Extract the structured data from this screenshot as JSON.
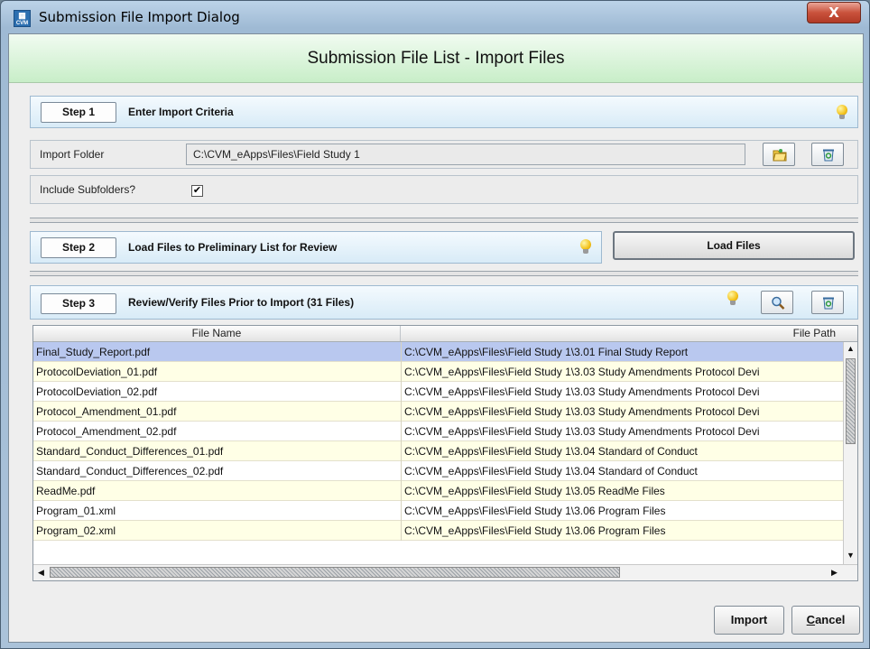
{
  "window": {
    "title": "Submission File Import Dialog",
    "app_icon_text": "CVM",
    "close_glyph": "X"
  },
  "header": {
    "title": "Submission File List - Import Files"
  },
  "step1": {
    "button": "Step 1",
    "label": "Enter Import Criteria",
    "import_folder_label": "Import Folder",
    "import_folder_value": "C:\\CVM_eApps\\Files\\Field Study 1",
    "include_subfolders_label": "Include Subfolders?",
    "include_subfolders_checked": "✔"
  },
  "step2": {
    "button": "Step 2",
    "label": "Load Files to Preliminary List for Review",
    "load_button": "Load Files"
  },
  "step3": {
    "button": "Step 3",
    "label": "Review/Verify Files Prior to Import  (31 Files)"
  },
  "grid": {
    "columns": [
      "File Name",
      "File Path"
    ],
    "rows": [
      {
        "name": "Final_Study_Report.pdf",
        "path": "C:\\CVM_eApps\\Files\\Field Study 1\\3.01 Final Study Report"
      },
      {
        "name": "ProtocolDeviation_01.pdf",
        "path": "C:\\CVM_eApps\\Files\\Field Study 1\\3.03 Study Amendments Protocol Devi"
      },
      {
        "name": "ProtocolDeviation_02.pdf",
        "path": "C:\\CVM_eApps\\Files\\Field Study 1\\3.03 Study Amendments Protocol Devi"
      },
      {
        "name": "Protocol_Amendment_01.pdf",
        "path": "C:\\CVM_eApps\\Files\\Field Study 1\\3.03 Study Amendments Protocol Devi"
      },
      {
        "name": "Protocol_Amendment_02.pdf",
        "path": "C:\\CVM_eApps\\Files\\Field Study 1\\3.03 Study Amendments Protocol Devi"
      },
      {
        "name": "Standard_Conduct_Differences_01.pdf",
        "path": "C:\\CVM_eApps\\Files\\Field Study 1\\3.04 Standard of Conduct"
      },
      {
        "name": "Standard_Conduct_Differences_02.pdf",
        "path": "C:\\CVM_eApps\\Files\\Field Study 1\\3.04 Standard of Conduct"
      },
      {
        "name": "ReadMe.pdf",
        "path": "C:\\CVM_eApps\\Files\\Field Study 1\\3.05 ReadMe Files"
      },
      {
        "name": "Program_01.xml",
        "path": "C:\\CVM_eApps\\Files\\Field Study 1\\3.06 Program Files"
      },
      {
        "name": "Program_02.xml",
        "path": "C:\\CVM_eApps\\Files\\Field Study 1\\3.06 Program Files"
      }
    ]
  },
  "footer": {
    "import_button": "Import",
    "cancel_button": "Cancel"
  },
  "colors": {
    "header_band": "#d6f3d6",
    "step_bar": "#e3f1fa",
    "row_alt": "#ffffe6",
    "row_selected": "#b9c8ef"
  },
  "icons": [
    "app-icon",
    "close-icon",
    "lightbulb-icon",
    "open-folder-icon",
    "clear-icon",
    "magnifier-icon"
  ]
}
